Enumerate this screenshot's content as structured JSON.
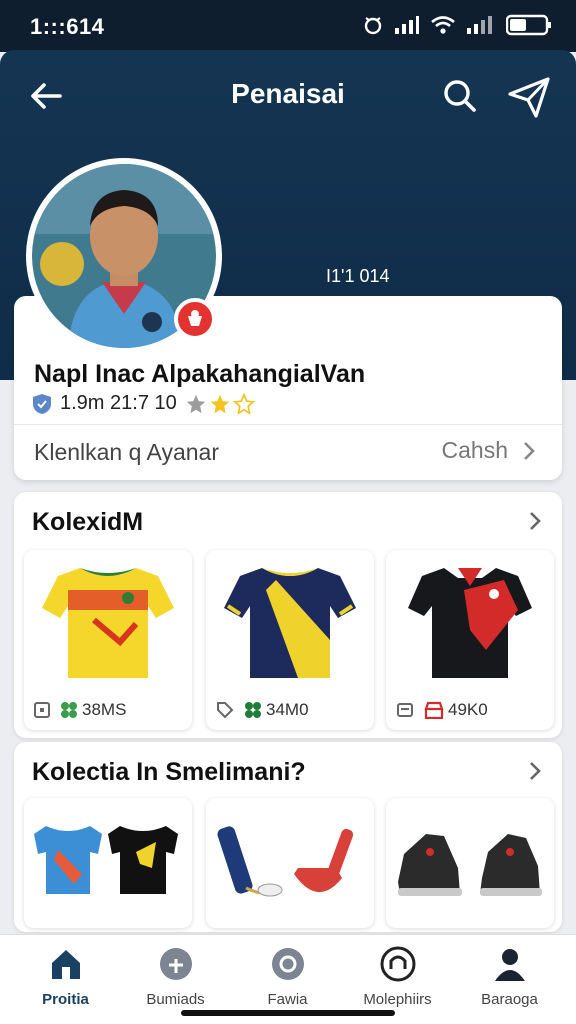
{
  "status_bar": {
    "time": "1:::614"
  },
  "header": {
    "title": "Penaisai",
    "meta": "I1'1 014"
  },
  "profile": {
    "name": "Napl Inac AlpakahangialVan",
    "stats": "1.9m 21:7 10",
    "rating": 3,
    "subtitle": "Klenlkan q Ayanar",
    "link_label": "Cahsh"
  },
  "section1": {
    "title": "KolexidM",
    "products": [
      {
        "price": "38MS",
        "image": "yellow-red-jersey"
      },
      {
        "price": "34M0",
        "image": "navy-yellow-jersey"
      },
      {
        "price": "49K0",
        "image": "black-red-polo"
      }
    ]
  },
  "section2": {
    "title": "Kolectia In Smelimani?",
    "items": [
      {
        "image": "two-jerseys"
      },
      {
        "image": "bottle-and-cap"
      },
      {
        "image": "black-sneakers"
      }
    ]
  },
  "nav": [
    {
      "label": "Proitia",
      "icon": "home-icon",
      "active": true
    },
    {
      "label": "Bumiads",
      "icon": "shop-icon",
      "active": false
    },
    {
      "label": "Fawia",
      "icon": "compass-icon",
      "active": false
    },
    {
      "label": "Molephiirs",
      "icon": "messages-icon",
      "active": false
    },
    {
      "label": "Baraoga",
      "icon": "profile-icon",
      "active": false
    }
  ],
  "colors": {
    "header_bg": "#143552",
    "accent": "#1a4163",
    "badge": "#e3322f",
    "star": "#f2c41c"
  }
}
